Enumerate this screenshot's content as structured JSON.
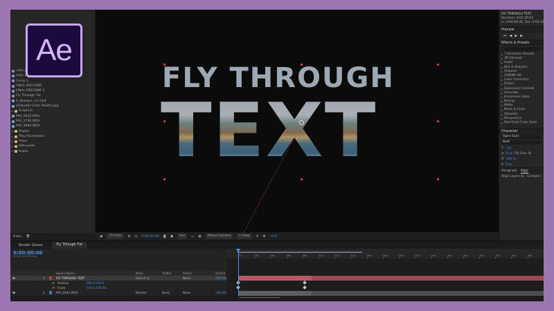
{
  "logo": {
    "text": "Ae"
  },
  "project": {
    "items": [
      {
        "name": "color profile 1",
        "kind": "comp"
      },
      {
        "name": "color profile 2",
        "kind": "comp"
      },
      {
        "name": "Comp 1",
        "kind": "comp"
      },
      {
        "name": "FINAL PRECOMP",
        "kind": "comp"
      },
      {
        "name": "FINAL PRECOMP 2",
        "kind": "comp"
      },
      {
        "name": "Fly Through Txt",
        "kind": "comp"
      },
      {
        "name": "G_Bumper_v1.mp4",
        "kind": "footage"
      },
      {
        "name": "Ghibudell Color Palette.jpg",
        "kind": "footage"
      },
      {
        "name": "Graphics",
        "kind": "folder"
      },
      {
        "name": "MVI_0042.MOV",
        "kind": "footage"
      },
      {
        "name": "MVI_2795.MOV",
        "kind": "footage"
      },
      {
        "name": "MVI_9994.MOV",
        "kind": "footage"
      },
      {
        "name": "Photos",
        "kind": "folder"
      },
      {
        "name": "Play Animations",
        "kind": "folder"
      },
      {
        "name": "Plays",
        "kind": "folder"
      },
      {
        "name": "Silhouette",
        "kind": "folder"
      },
      {
        "name": "Solids",
        "kind": "folder"
      }
    ],
    "footer": "8 bpc"
  },
  "viewer": {
    "line1": "FLY THROUGH",
    "line2": "TEXT"
  },
  "viewer_toolbar": {
    "zoom": "(73.2%)",
    "time": "0:00:00:00",
    "resolution": "Full",
    "camera": "Active Camera",
    "views": "1 View",
    "exposure": "+0.0"
  },
  "info": {
    "title": "FLY THROUGH TEXT",
    "duration": "Duration: 0:02:26:04",
    "inout": "In: 0:00:00:00, Out: 0:02:26:03"
  },
  "preview": {
    "title": "Preview"
  },
  "effects": {
    "title": "Effects & Presets",
    "items": [
      "* Animation Presets",
      "3D Channel",
      "Audio",
      "Blur & Sharpen",
      "Channel",
      "CINEMA 4D",
      "Color Correction",
      "Distort",
      "Expression Controls",
      "Generate",
      "Immersive Video",
      "Keying",
      "Matte",
      "Noise & Grain",
      "Obsolete",
      "Perspective",
      "Red Giant Color Suite"
    ]
  },
  "character": {
    "title": "Character",
    "font": "Open Sans",
    "style": "Bold",
    "size": "- px",
    "tracking": "0 px",
    "stroke": "Fill Over St",
    "scale_v": "100 %",
    "baseline": "0 px"
  },
  "paragraph": {
    "tab1": "Paragraph",
    "tab2": "Align"
  },
  "align": {
    "label": "Align Layers to:",
    "value": "Composi"
  },
  "timeline": {
    "tab_render": "Render Queue",
    "tab_comp": "Fly Through Txt",
    "timecode": "0:00:00:00",
    "timecode_sub": "00000 (23.976 fps)",
    "header": {
      "source": "Source Name",
      "mode": "Mode",
      "trkmat": "TrkMat",
      "parent": "Parent",
      "stretch": "Stretch"
    },
    "layers": [
      {
        "num": "1",
        "name": "FLY THROUGH TEXT",
        "mode": "Stencil Lu",
        "parent": "None",
        "stretch": "100.0%"
      },
      {
        "num": "",
        "name": "Position",
        "value": "960.0,540.0"
      },
      {
        "num": "",
        "name": "Scale",
        "value": "100.0,100.0%"
      },
      {
        "num": "2",
        "name": "MVI_0042.MOV",
        "mode": "Normal",
        "trkmat": "None",
        "parent": "None",
        "stretch": "100.0%"
      }
    ],
    "ruler": [
      "0s",
      "02s",
      "04s",
      "06s",
      "08s",
      "10s",
      "12s",
      "14s",
      "16s",
      "18s",
      "20s",
      "22s",
      "24s",
      "26s",
      "28s",
      "30s",
      "32s",
      "34s",
      "36s",
      "38s",
      "40s"
    ]
  }
}
